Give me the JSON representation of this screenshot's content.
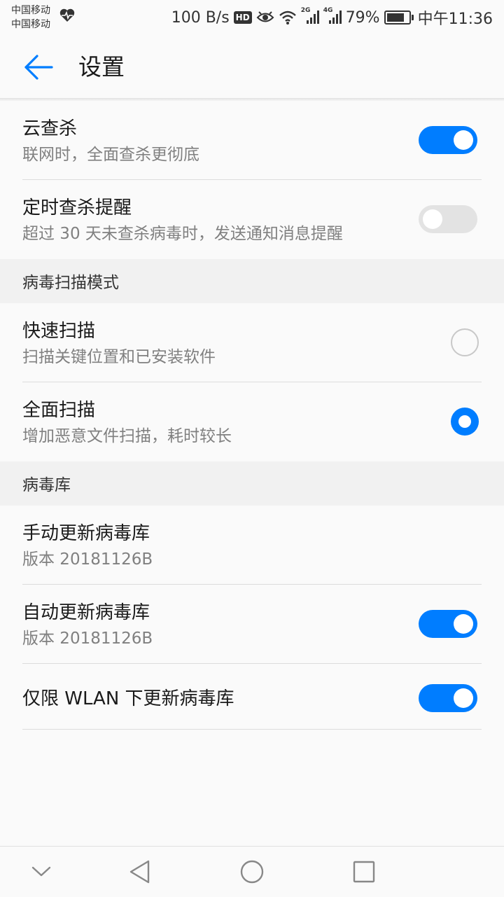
{
  "status_bar": {
    "carrier_1": "中国移动",
    "carrier_2": "中国移动",
    "net_speed": "100 B/s",
    "hd_badge": "HD",
    "signal_1_label": "2G",
    "signal_2_label": "4G",
    "battery": "79%",
    "time": "中午11:36",
    "icons": [
      "heart-rate-icon",
      "eye-icon",
      "wifi-icon",
      "signal-icon",
      "battery-icon"
    ]
  },
  "header": {
    "title": "设置",
    "back_icon": "arrow-left-icon"
  },
  "settings": {
    "cloud_scan": {
      "title": "云查杀",
      "subtitle": "联网时，全面查杀更彻底",
      "enabled": true
    },
    "scheduled_reminder": {
      "title": "定时查杀提醒",
      "subtitle": "超过 30 天未查杀病毒时，发送通知消息提醒",
      "enabled": false
    }
  },
  "scan_mode": {
    "header": "病毒扫描模式",
    "quick": {
      "title": "快速扫描",
      "subtitle": "扫描关键位置和已安装软件",
      "selected": false
    },
    "full": {
      "title": "全面扫描",
      "subtitle": "增加恶意文件扫描，耗时较长",
      "selected": true
    }
  },
  "virus_db": {
    "header": "病毒库",
    "manual": {
      "title": "手动更新病毒库",
      "subtitle": "版本 20181126B"
    },
    "auto": {
      "title": "自动更新病毒库",
      "subtitle": "版本 20181126B",
      "enabled": true
    },
    "wlan_only": {
      "title": "仅限 WLAN 下更新病毒库",
      "enabled": true
    }
  },
  "nav_bar": {
    "icons": [
      "chevron-down-icon",
      "back-triangle-icon",
      "home-circle-icon",
      "recents-square-icon"
    ]
  },
  "colors": {
    "accent": "#007dff",
    "toggle_off": "#e3e3e3",
    "section_bg": "#f1f1f1"
  }
}
